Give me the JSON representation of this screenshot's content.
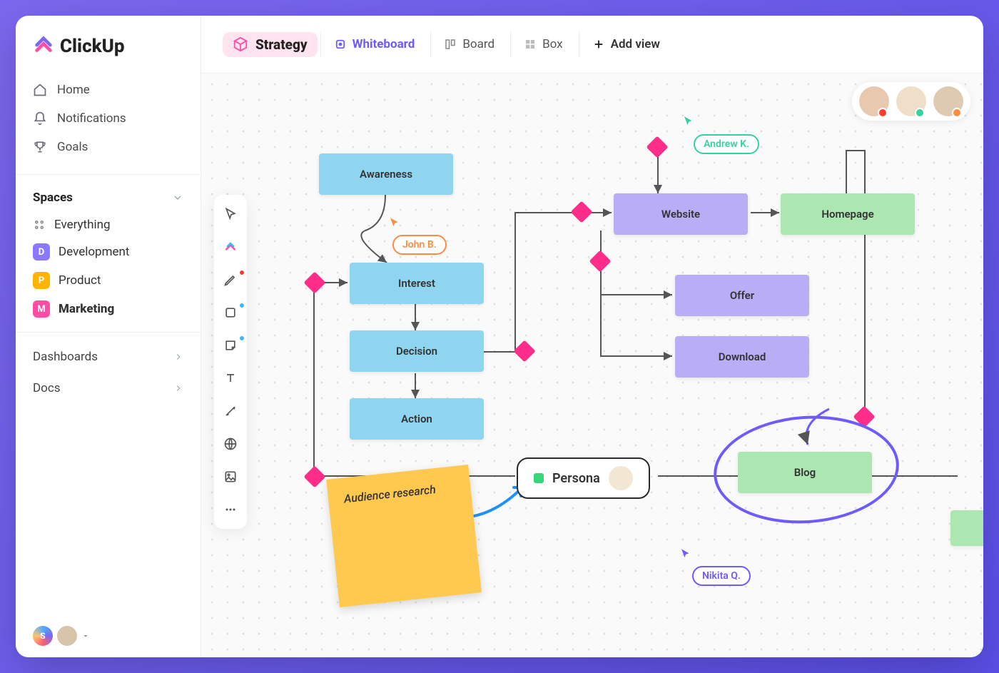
{
  "brand": "ClickUp",
  "nav": {
    "home": "Home",
    "notifications": "Notifications",
    "goals": "Goals"
  },
  "spaces": {
    "header": "Spaces",
    "everything": "Everything",
    "items": [
      {
        "letter": "D",
        "label": "Development",
        "color": "#8a78ff"
      },
      {
        "letter": "P",
        "label": "Product",
        "color": "#ffb400"
      },
      {
        "letter": "M",
        "label": "Marketing",
        "color": "#ff4da6"
      }
    ]
  },
  "sections": {
    "dashboards": "Dashboards",
    "docs": "Docs"
  },
  "user_footer_letter": "S",
  "topbar": {
    "title": "Strategy",
    "views": {
      "whiteboard": "Whiteboard",
      "board": "Board",
      "box": "Box",
      "add": "Add view"
    }
  },
  "tools": [
    "select",
    "clickup",
    "pen",
    "shapes",
    "sticky",
    "text",
    "connector",
    "web",
    "image",
    "more"
  ],
  "diagram": {
    "nodes": {
      "awareness": "Awareness",
      "interest": "Interest",
      "decision": "Decision",
      "action": "Action",
      "website": "Website",
      "homepage": "Homepage",
      "offer": "Offer",
      "download": "Download",
      "blog": "Blog",
      "persona": "Persona"
    },
    "sticky_text": "Audience research",
    "user_tags": {
      "john": "John B.",
      "andrew": "Andrew K.",
      "nikita": "Nikita Q."
    }
  },
  "collaborators_count": 3,
  "colors": {
    "accent": "#7B68EE",
    "pink": "#ff2d8a",
    "blue_node": "#90d5f0",
    "purple_node": "#b9aef5",
    "green_node": "#ace7b2",
    "sticky": "#ffc94f"
  }
}
